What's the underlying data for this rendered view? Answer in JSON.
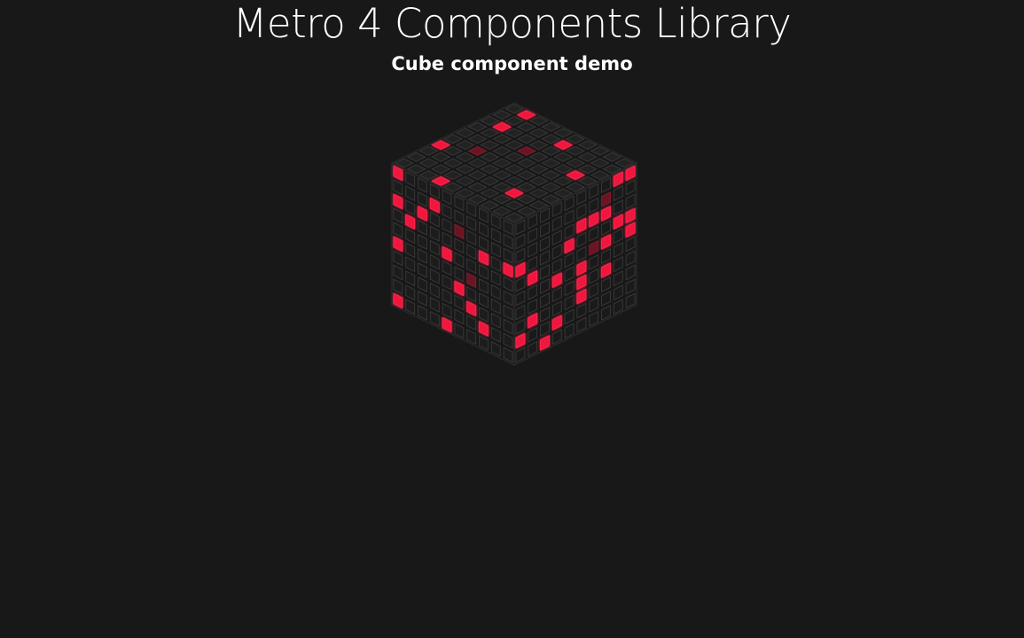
{
  "header": {
    "title": "Metro 4 Components Library",
    "subtitle": "Cube component demo"
  },
  "cube": {
    "grid_size": 10,
    "cell_color": "#1e1e1e",
    "cell_border_color": "#3a3a3a",
    "flash_color": "#f0143c",
    "background": "#181818",
    "faces": {
      "top": {
        "lit": [
          [
            0,
            3
          ],
          [
            1,
            7
          ],
          [
            1,
            9
          ],
          [
            3,
            0
          ],
          [
            5,
            8
          ],
          [
            7,
            2
          ],
          [
            8,
            6
          ]
        ],
        "dim": [
          [
            2,
            4
          ],
          [
            4,
            6
          ]
        ]
      },
      "left": {
        "lit": [
          [
            0,
            0
          ],
          [
            1,
            3
          ],
          [
            2,
            0
          ],
          [
            2,
            2
          ],
          [
            3,
            1
          ],
          [
            3,
            7
          ],
          [
            3,
            9
          ],
          [
            4,
            4
          ],
          [
            5,
            0
          ],
          [
            6,
            5
          ],
          [
            7,
            6
          ],
          [
            9,
            0
          ],
          [
            9,
            4
          ],
          [
            8,
            7
          ]
        ],
        "dim": [
          [
            2,
            5
          ],
          [
            5,
            6
          ]
        ]
      },
      "right": {
        "lit": [
          [
            0,
            8
          ],
          [
            0,
            9
          ],
          [
            2,
            5
          ],
          [
            2,
            6
          ],
          [
            2,
            7
          ],
          [
            3,
            0
          ],
          [
            3,
            4
          ],
          [
            3,
            8
          ],
          [
            3,
            9
          ],
          [
            4,
            1
          ],
          [
            4,
            7
          ],
          [
            5,
            3
          ],
          [
            5,
            5
          ],
          [
            6,
            5
          ],
          [
            6,
            7
          ],
          [
            7,
            1
          ],
          [
            7,
            5
          ],
          [
            8,
            0
          ],
          [
            8,
            3
          ],
          [
            9,
            2
          ],
          [
            4,
            9
          ]
        ],
        "dim": [
          [
            1,
            7
          ],
          [
            4,
            6
          ]
        ]
      }
    }
  }
}
